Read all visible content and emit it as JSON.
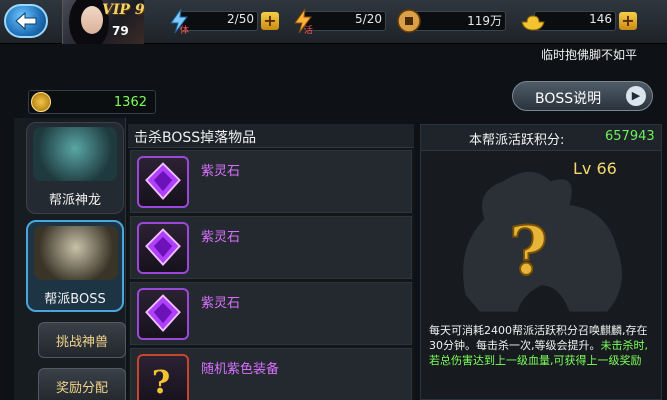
{
  "header": {
    "vip_label": "VIP 9",
    "player_level": "79",
    "stamina_value": "2/50",
    "stamina_icon": "lightning-stamina-icon",
    "energy_value": "5/20",
    "energy_icon": "lightning-energy-icon",
    "coins_value": "119万",
    "gold_value": "146",
    "plus_label": "+"
  },
  "subtitle": "临时抱佛脚不如平",
  "points": {
    "value": "1362"
  },
  "boss_button": {
    "label": "BOSS说明",
    "arrow": "▶"
  },
  "tabs": [
    {
      "label": "帮派神龙"
    },
    {
      "label": "帮派BOSS"
    },
    {
      "label": "挑战神兽"
    },
    {
      "label": "奖励分配"
    }
  ],
  "drops": {
    "title": "击杀BOSS掉落物品",
    "items": [
      {
        "name": "紫灵石",
        "icon": "purple-gem-icon"
      },
      {
        "name": "紫灵石",
        "icon": "purple-gem-icon"
      },
      {
        "name": "紫灵石",
        "icon": "purple-gem-icon"
      },
      {
        "name": "随机紫色装备",
        "icon": "question-mark-icon"
      }
    ]
  },
  "boss": {
    "activity_label": "本帮派活跃积分:",
    "activity_value": "657943",
    "level": "Lv 66",
    "desc_white": "每天可消耗2400帮派活跃积分召唤麒麟,存在30分钟。每击杀一次,等级会提升。",
    "desc_green": "未击杀时,若总伤害达到上一级血量,可获得上一级奖励"
  },
  "colors": {
    "accent_blue": "#49a6df",
    "purple_item": "#d970ff",
    "green_value": "#7cff5a",
    "gold": "#f5d86a"
  }
}
